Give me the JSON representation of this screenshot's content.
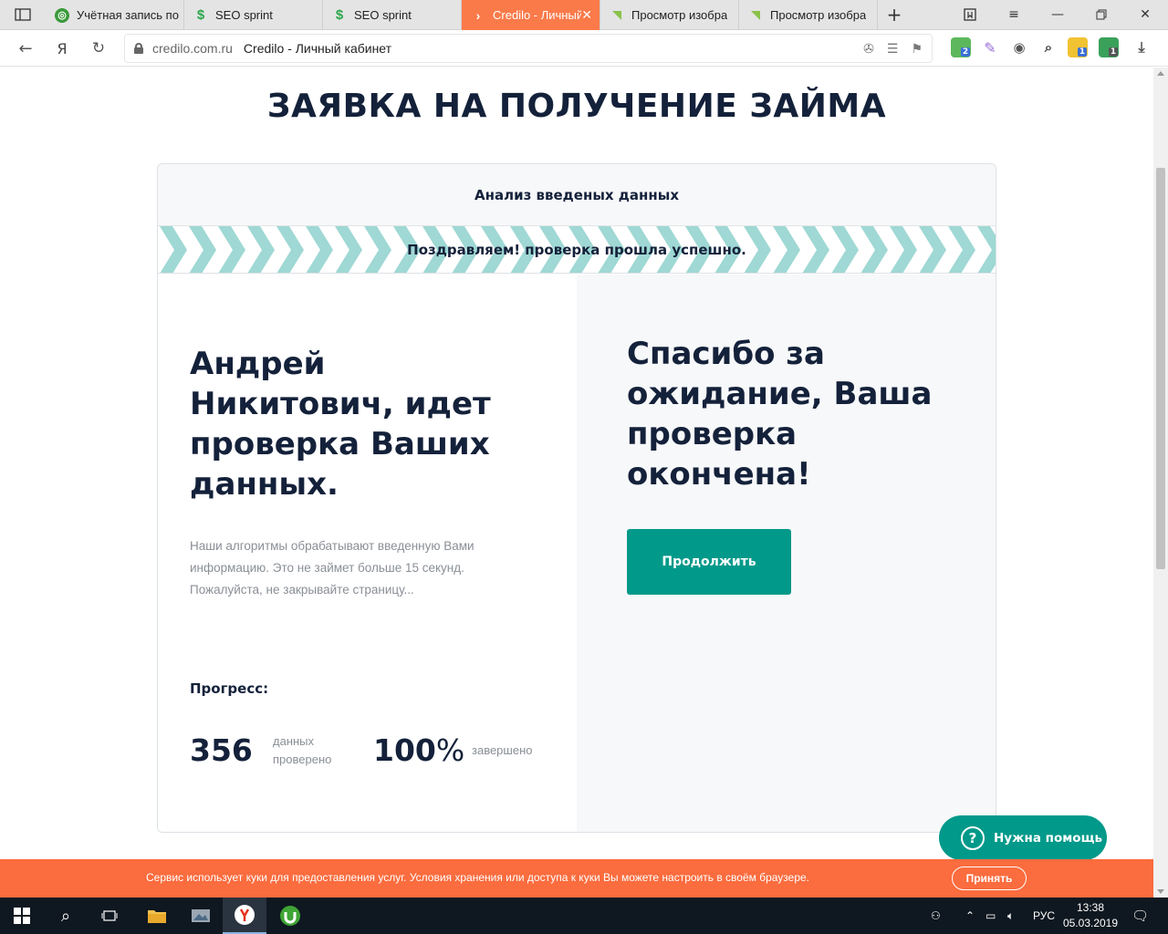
{
  "browser": {
    "tabs": [
      {
        "label": "Учётная запись по",
        "icon": "account-globe-icon"
      },
      {
        "label": "SEO sprint",
        "icon": "seo-sprint-icon"
      },
      {
        "label": "SEO sprint",
        "icon": "seo-sprint-icon"
      },
      {
        "label": "Credilo - Личный",
        "icon": "credilo-arrow-icon",
        "active": true
      },
      {
        "label": "Просмотр изобра",
        "icon": "image-viewer-icon"
      },
      {
        "label": "Просмотр изобра",
        "icon": "image-viewer-icon"
      }
    ],
    "url_host": "credilo.com.ru",
    "url_title": "Credilo - Личный кабинет",
    "yandex_letter": "Я",
    "extension_badges": {
      "ext1": "2",
      "ext2": "1",
      "ext3": "1"
    }
  },
  "page": {
    "title": "ЗАЯВКА НА ПОЛУЧЕНИЕ ЗАЙМА",
    "card_header": "Анализ введеных данных",
    "stripe_message": "Поздравляем! проверка прошла успешно.",
    "left": {
      "heading": "Андрей Никитович, идет проверка Ваших данных.",
      "description": "Наши алгоритмы обрабатывают введенную Вами информацию. Это не займет больше 15 секунд. Пожалуйста, не закрывайте страницу...",
      "progress_label": "Прогресс:",
      "stat1_value": "356",
      "stat1_label_1": "данных",
      "stat1_label_2": "проверено",
      "stat2_value": "100",
      "stat2_unit": "%",
      "stat2_label": "завершено"
    },
    "right": {
      "heading": "Спасибо за ожидание, Ваша проверка окончена!",
      "button_label": "Продолжить"
    },
    "help_button": "Нужна помощь",
    "cookie_text": "Сервис использует куки для предоставления услуг. Условия хранения или доступа к куки Вы можете настроить в своём браузере.",
    "cookie_button": "Принять"
  },
  "colors": {
    "accent": "#00998a",
    "stripe": "#9fd8d4",
    "cookie_bar": "#fb6c3e",
    "active_tab": "#fb7a4a",
    "heading_text": "#14213a"
  },
  "taskbar": {
    "language": "РУС",
    "time": "13:38",
    "date": "05.03.2019"
  }
}
